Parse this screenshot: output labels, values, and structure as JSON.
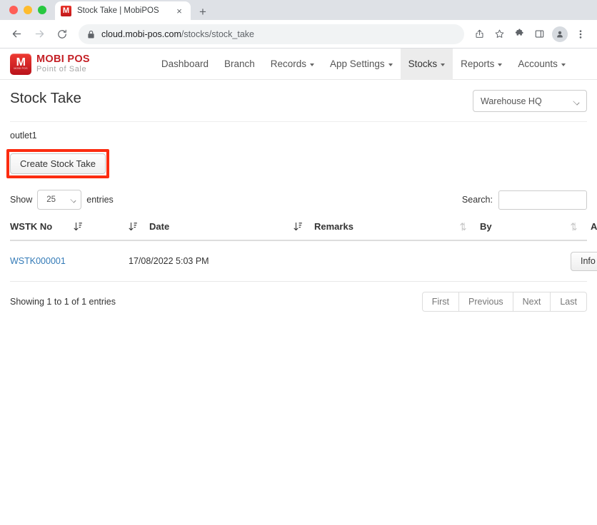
{
  "browser": {
    "tab_title": "Stock Take | MobiPOS",
    "favicon_letter": "M",
    "url_domain": "cloud.mobi-pos.com",
    "url_path": "/stocks/stock_take",
    "new_tab_label": "+",
    "close_tab_label": "×"
  },
  "app": {
    "brand_name": "MOBI POS",
    "brand_tagline": "Point of Sale",
    "brand_mark_letter": "M",
    "brand_mark_sub": "MOBI POS",
    "nav": [
      {
        "label": "Dashboard",
        "has_caret": false,
        "active": false
      },
      {
        "label": "Branch",
        "has_caret": false,
        "active": false
      },
      {
        "label": "Records",
        "has_caret": true,
        "active": false
      },
      {
        "label": "App Settings",
        "has_caret": true,
        "active": false
      },
      {
        "label": "Stocks",
        "has_caret": true,
        "active": true
      },
      {
        "label": "Reports",
        "has_caret": true,
        "active": false
      },
      {
        "label": "Accounts",
        "has_caret": true,
        "active": false
      }
    ]
  },
  "page": {
    "title": "Stock Take",
    "outlet_selector_value": "Warehouse HQ",
    "outlet_name": "outlet1",
    "create_button_label": "Create Stock Take",
    "annotation_color": "#fc2c10"
  },
  "table_controls": {
    "show_label": "Show",
    "entries_label": "entries",
    "page_length_value": "25",
    "search_label": "Search:",
    "search_value": "",
    "search_placeholder": ""
  },
  "table": {
    "columns": [
      {
        "label": "WSTK No",
        "sort_state": "desc"
      },
      {
        "label": "Date",
        "sort_state": "desc"
      },
      {
        "label": "Remarks",
        "sort_state": "none"
      },
      {
        "label": "By",
        "sort_state": "none"
      },
      {
        "label": "Action",
        "sort_state": "none"
      }
    ],
    "rows": [
      {
        "wstk_no": "WSTK000001",
        "date": "17/08/2022 5:03 PM",
        "remarks": "",
        "by": "",
        "action_label": "Info"
      }
    ]
  },
  "footer": {
    "showing_info": "Showing 1 to 1 of 1 entries",
    "pagination": [
      "First",
      "Previous",
      "Next",
      "Last"
    ]
  }
}
